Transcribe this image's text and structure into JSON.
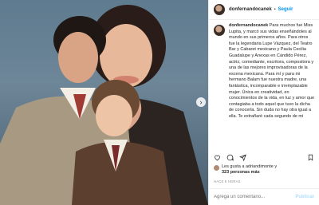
{
  "header": {
    "username": "donfernandocanek",
    "separator": "•",
    "follow_label": "Seguir"
  },
  "caption": {
    "username": "donfernandocanek",
    "text": "Para muchos fue Miss Lupita, y marcó sus vidas enseñándoles al mundo en sus primeros años. Para otros fue la legendaria Lupe Vázquez, del Teatro Bar y Cabaret mexicano y Paula Cecilia Guadalupe y Anexas en Cándido Pérez, actriz, comediante, escritora, compositora y una de las mejores improvisadoras de la escena mexicana. Para mí y para mi hermano Balam fue nuestra madre, una fantástica, incomparable e irremplazable mujer. Única en creatividad, en conocimientos de la vida, en luz y amor que contagiaba a todo aquel que tuvo la dicha de conocerla. Sin duda no hay otra igual a ella. Te extrañaré cada segundo de mi"
  },
  "likes": {
    "line1": "Les gusta a adriandimonte y",
    "line2": "323 personas más"
  },
  "time_label": "HACE 5 HORAS",
  "comment": {
    "placeholder": "Agrega un comentario...",
    "publish_label": "Publicar"
  },
  "icons": {
    "like": "heart-icon",
    "comment": "comment-icon",
    "share": "share-icon",
    "save": "bookmark-icon",
    "next": "chevron-right-icon"
  }
}
